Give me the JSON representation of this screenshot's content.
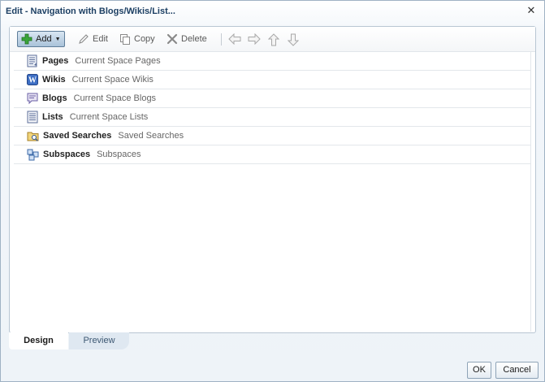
{
  "dialog": {
    "title": "Edit - Navigation with Blogs/Wikis/List...",
    "close_glyph": "✕"
  },
  "toolbar": {
    "add_label": "Add",
    "edit_label": "Edit",
    "copy_label": "Copy",
    "delete_label": "Delete"
  },
  "items": [
    {
      "name": "Pages",
      "desc": "Current Space Pages",
      "icon": "pages-icon"
    },
    {
      "name": "Wikis",
      "desc": "Current Space Wikis",
      "icon": "wikis-icon"
    },
    {
      "name": "Blogs",
      "desc": "Current Space Blogs",
      "icon": "blogs-icon"
    },
    {
      "name": "Lists",
      "desc": "Current Space Lists",
      "icon": "lists-icon"
    },
    {
      "name": "Saved Searches",
      "desc": "Saved Searches",
      "icon": "saved-searches-icon"
    },
    {
      "name": "Subspaces",
      "desc": "Subspaces",
      "icon": "subspaces-icon"
    }
  ],
  "tabs": {
    "design": "Design",
    "preview": "Preview"
  },
  "footer": {
    "ok_label": "OK",
    "cancel_label": "Cancel"
  },
  "colors": {
    "title": "#1c3f63",
    "add_button": "#a9c2d9",
    "preview_tab": "#dfe8f1"
  }
}
